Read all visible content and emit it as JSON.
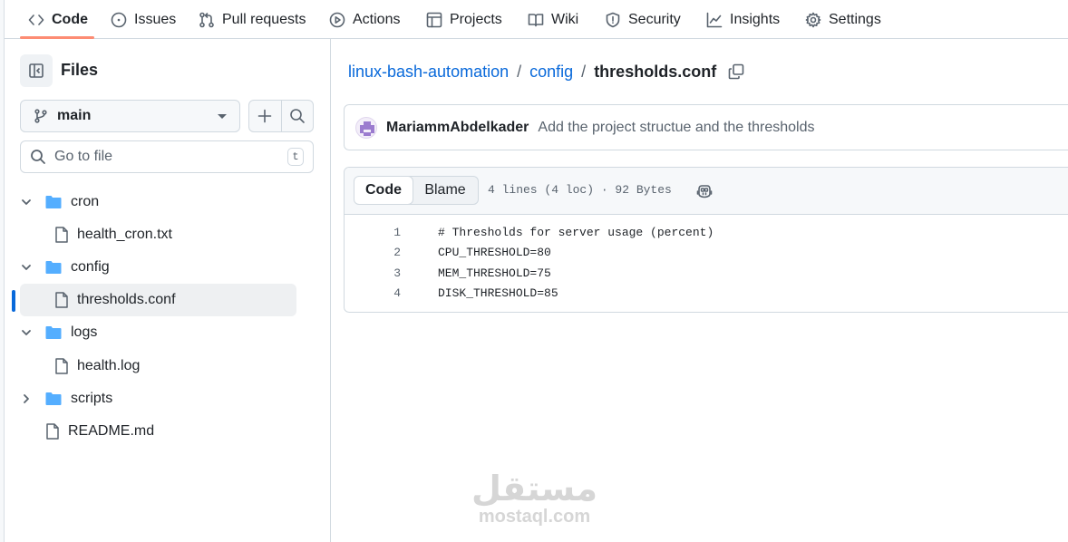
{
  "nav": {
    "items": [
      {
        "label": "Code",
        "icon": "code-icon",
        "active": true
      },
      {
        "label": "Issues",
        "icon": "issue-opened-icon"
      },
      {
        "label": "Pull requests",
        "icon": "git-pull-request-icon"
      },
      {
        "label": "Actions",
        "icon": "play-icon"
      },
      {
        "label": "Projects",
        "icon": "table-icon"
      },
      {
        "label": "Wiki",
        "icon": "book-icon"
      },
      {
        "label": "Security",
        "icon": "shield-icon"
      },
      {
        "label": "Insights",
        "icon": "graph-icon"
      },
      {
        "label": "Settings",
        "icon": "gear-icon"
      }
    ],
    "active_color": "#fd8c73"
  },
  "sidebar": {
    "title": "Files",
    "branch": "main",
    "search_placeholder": "Go to file",
    "search_shortcut": "t",
    "tree": [
      {
        "label": "cron",
        "type": "folder",
        "expanded": true
      },
      {
        "label": "health_cron.txt",
        "type": "file"
      },
      {
        "label": "config",
        "type": "folder",
        "expanded": true
      },
      {
        "label": "thresholds.conf",
        "type": "file",
        "selected": true
      },
      {
        "label": "logs",
        "type": "folder",
        "expanded": true
      },
      {
        "label": "health.log",
        "type": "file"
      },
      {
        "label": "scripts",
        "type": "folder",
        "expanded": false
      },
      {
        "label": "README.md",
        "type": "file"
      }
    ]
  },
  "breadcrumb": {
    "repo": "linux-bash-automation",
    "folder": "config",
    "file": "thresholds.conf",
    "separator": "/"
  },
  "commit": {
    "author": "MariammAbdelkader",
    "message": "Add the project structue and the thresholds"
  },
  "file_view": {
    "tabs": [
      "Code",
      "Blame"
    ],
    "active_tab": "Code",
    "meta": "4 lines (4 loc) · 92 Bytes",
    "lines": [
      {
        "num": "1",
        "text": "# Thresholds for server usage (percent)"
      },
      {
        "num": "2",
        "text": "CPU_THRESHOLD=80"
      },
      {
        "num": "3",
        "text": "MEM_THRESHOLD=75"
      },
      {
        "num": "4",
        "text": "DISK_THRESHOLD=85"
      }
    ]
  },
  "watermark": {
    "arabic": "مستقل",
    "latin": "mostaql.com"
  },
  "colors": {
    "link": "#0969da",
    "folder": "#54aeff",
    "selected_bar": "#0969da"
  }
}
